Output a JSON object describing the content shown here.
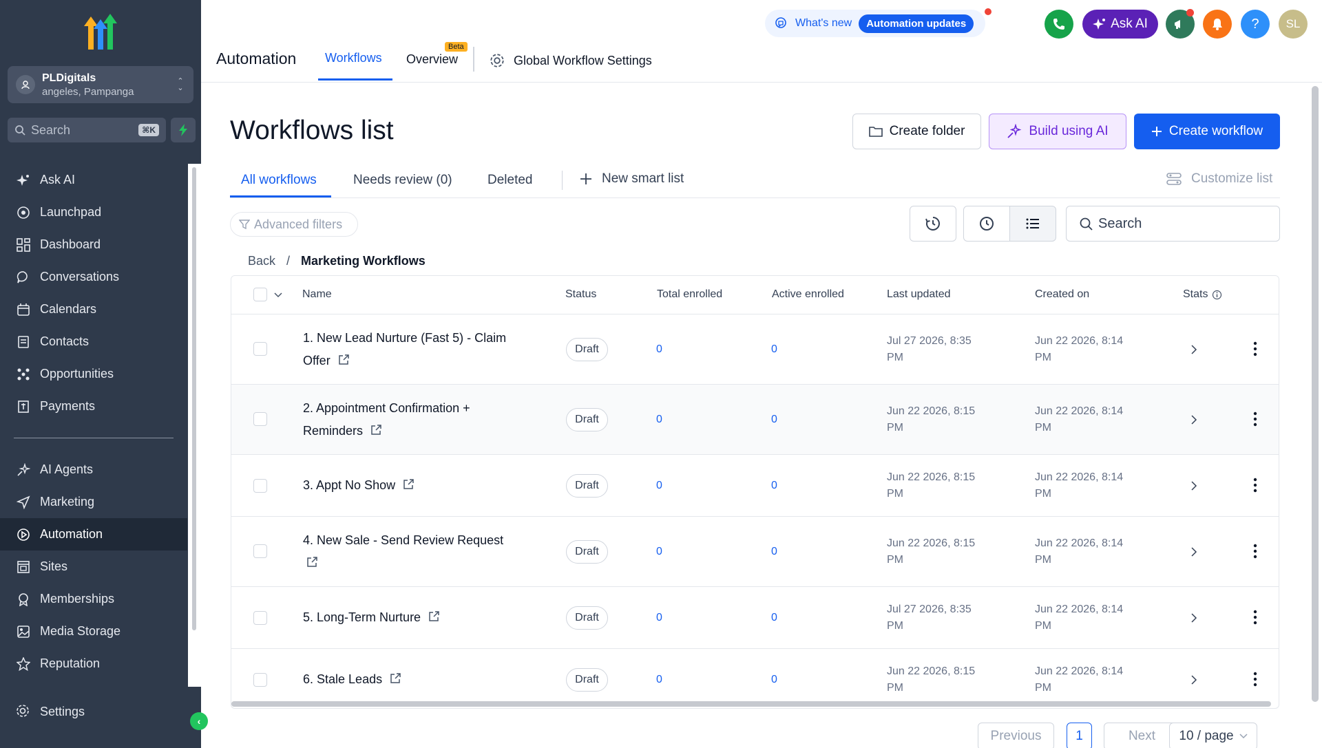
{
  "sidebar": {
    "account": {
      "name": "PLDigitals",
      "location": "angeles, Pampanga"
    },
    "search": {
      "label": "Search",
      "shortcut": "⌘K"
    },
    "items": [
      {
        "label": "Ask AI",
        "icon": "sparkle-icon"
      },
      {
        "label": "Launchpad",
        "icon": "launchpad-icon"
      },
      {
        "label": "Dashboard",
        "icon": "dashboard-icon"
      },
      {
        "label": "Conversations",
        "icon": "chat-icon"
      },
      {
        "label": "Calendars",
        "icon": "calendar-icon"
      },
      {
        "label": "Contacts",
        "icon": "contacts-icon"
      },
      {
        "label": "Opportunities",
        "icon": "opportunities-icon"
      },
      {
        "label": "Payments",
        "icon": "payments-icon"
      },
      {
        "label": "AI Agents",
        "icon": "ai-agents-icon"
      },
      {
        "label": "Marketing",
        "icon": "send-icon"
      },
      {
        "label": "Automation",
        "icon": "automation-icon",
        "active": true
      },
      {
        "label": "Sites",
        "icon": "sites-icon"
      },
      {
        "label": "Memberships",
        "icon": "memberships-icon"
      },
      {
        "label": "Media Storage",
        "icon": "image-icon"
      },
      {
        "label": "Reputation",
        "icon": "star-icon"
      }
    ],
    "settings_label": "Settings"
  },
  "topbar": {
    "app_title": "Automation",
    "tabs": {
      "workflows": "Workflows",
      "overview": "Overview",
      "beta": "Beta",
      "global": "Global Workflow Settings"
    },
    "whats_new": "What's new",
    "whats_new_pill": "Automation updates",
    "ask_ai": "Ask AI",
    "help": "?",
    "user_initials": "SL"
  },
  "colors": {
    "primary": "#155eef",
    "sidebar_bg": "#2f3a4b",
    "phone": "#16a34a",
    "megaphone": "#2f7a5b",
    "bell": "#f97316",
    "help": "#2e90fa",
    "avatar": "#c7bd8a",
    "ask_ai": "#5b21b6"
  },
  "main": {
    "title": "Workflows list",
    "buttons": {
      "create_folder": "Create folder",
      "build_ai": "Build using AI",
      "create_workflow": "Create workflow"
    },
    "subtabs": {
      "all": "All workflows",
      "review": "Needs review (0)",
      "deleted": "Deleted",
      "smart": "New smart list"
    },
    "customize": "Customize list",
    "advanced_filters": "Advanced filters",
    "search_placeholder": "Search",
    "breadcrumb": {
      "back": "Back",
      "sep": "/",
      "current": "Marketing Workflows"
    }
  },
  "table": {
    "headers": {
      "name": "Name",
      "status": "Status",
      "total": "Total enrolled",
      "active": "Active enrolled",
      "updated": "Last updated",
      "created": "Created on",
      "stats": "Stats"
    },
    "rows": [
      {
        "name": "1. New Lead Nurture (Fast 5) - Claim Offer",
        "status": "Draft",
        "total": "0",
        "active": "0",
        "updated": "Jul 27 2026, 8:35 PM",
        "created": "Jun 22 2026, 8:14 PM"
      },
      {
        "name": "2. Appointment Confirmation + Reminders",
        "status": "Draft",
        "total": "0",
        "active": "0",
        "updated": "Jun 22 2026, 8:15 PM",
        "created": "Jun 22 2026, 8:14 PM"
      },
      {
        "name": "3. Appt No Show",
        "status": "Draft",
        "total": "0",
        "active": "0",
        "updated": "Jun 22 2026, 8:15 PM",
        "created": "Jun 22 2026, 8:14 PM"
      },
      {
        "name": "4. New Sale - Send Review Request",
        "status": "Draft",
        "total": "0",
        "active": "0",
        "updated": "Jun 22 2026, 8:15 PM",
        "created": "Jun 22 2026, 8:14 PM"
      },
      {
        "name": "5. Long-Term Nurture",
        "status": "Draft",
        "total": "0",
        "active": "0",
        "updated": "Jul 27 2026, 8:35 PM",
        "created": "Jun 22 2026, 8:14 PM"
      },
      {
        "name": "6. Stale Leads",
        "status": "Draft",
        "total": "0",
        "active": "0",
        "updated": "Jun 22 2026, 8:15 PM",
        "created": "Jun 22 2026, 8:14 PM"
      }
    ]
  },
  "pagination": {
    "previous": "Previous",
    "page": "1",
    "next": "Next",
    "size": "10 / page"
  }
}
